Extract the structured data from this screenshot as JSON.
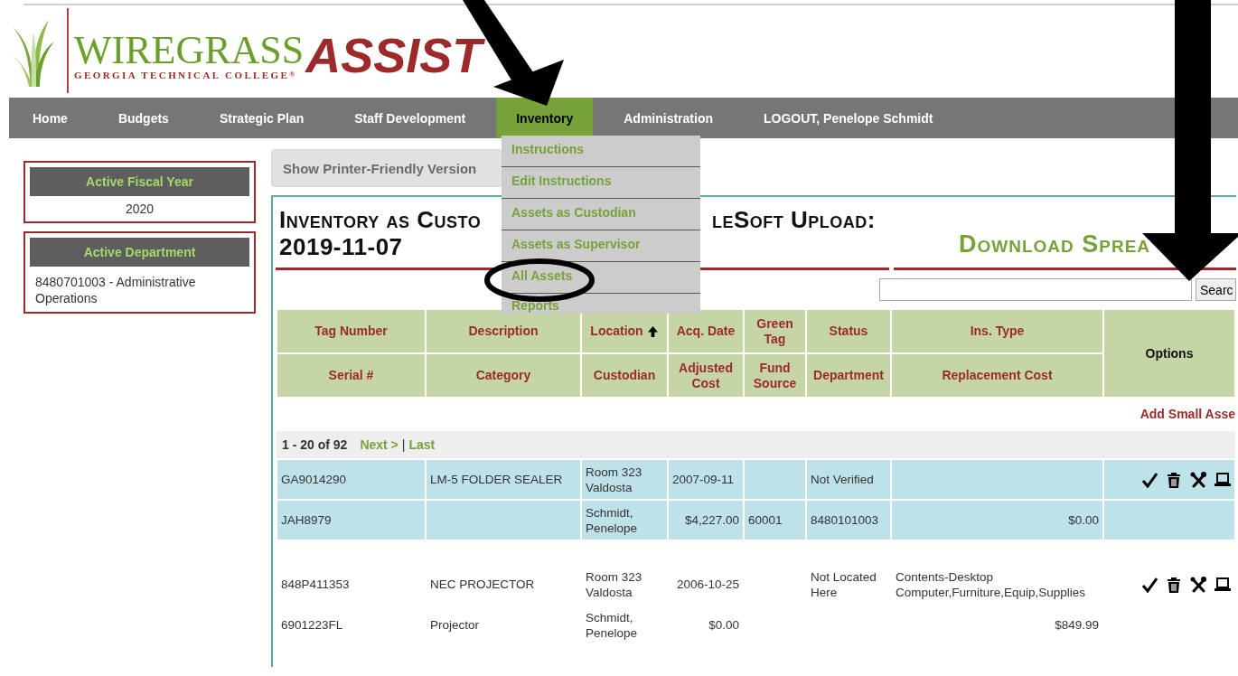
{
  "logo": {
    "name": "WIREGRASS",
    "subtitle": "GEORGIA TECHNICAL COLLEGE",
    "registered": "®",
    "app": "ASSIST"
  },
  "nav": [
    {
      "label": "Home",
      "selected": false
    },
    {
      "label": "Budgets",
      "selected": false
    },
    {
      "label": "Strategic Plan",
      "selected": false
    },
    {
      "label": "Staff Development",
      "selected": false
    },
    {
      "label": "Inventory",
      "selected": true
    },
    {
      "label": "Administration",
      "selected": false
    },
    {
      "label": "LOGOUT, Penelope Schmidt",
      "selected": false
    }
  ],
  "dropdown": {
    "items": [
      "Instructions",
      "Edit Instructions",
      "Assets as Custodian",
      "Assets as Supervisor",
      "All Assets",
      "Reports"
    ]
  },
  "sidebar": [
    {
      "kind": "centered",
      "title": "Active Fiscal Year",
      "value": "2020"
    },
    {
      "kind": "left",
      "title": "Active Department",
      "value": "8480701003 - Administrative Operations"
    }
  ],
  "printer_button": "Show Printer-Friendly Version",
  "heading": {
    "parts": [
      "Inventory as Custo",
      "leSoft Upload:"
    ],
    "date": "2019-11-07"
  },
  "download_link": "Download Sprea",
  "search": {
    "button": "Searc"
  },
  "table": {
    "header_rows": [
      [
        {
          "label": "Tag Number",
          "sorted": false
        },
        {
          "label": "Description",
          "sorted": false
        },
        {
          "label": "Location",
          "sorted": true
        },
        {
          "label": "Acq. Date",
          "sorted": false
        },
        {
          "label": "Green Tag",
          "sorted": false
        },
        {
          "label": "Status",
          "sorted": false
        },
        {
          "label": "Ins. Type",
          "sorted": false
        }
      ],
      [
        {
          "label": "Serial #",
          "sorted": false
        },
        {
          "label": "Category",
          "sorted": false
        },
        {
          "label": "Custodian",
          "sorted": false
        },
        {
          "label": "Adjusted Cost",
          "sorted": false
        },
        {
          "label": "Fund Source",
          "sorted": false
        },
        {
          "label": "Department",
          "sorted": false
        },
        {
          "label": "Replacement Cost",
          "sorted": false
        }
      ]
    ],
    "options_header": "Options"
  },
  "add_link": "Add Small Asse",
  "pagination": {
    "range": "1 - 20 of 92",
    "next": "Next >",
    "separator": "|",
    "last": "Last"
  },
  "records": [
    {
      "selected": true,
      "tag_number": "GA9014290",
      "description": "LM-5 FOLDER SEALER",
      "location": "Room 323 Valdosta",
      "acq_date": "2007-09-11",
      "status": "Not Verified",
      "serial": "JAH8979",
      "custodian": "Schmidt, Penelope",
      "adjusted_cost": "$4,227.00",
      "fund_source": "60001",
      "department": "8480101003",
      "replacement_cost": "$0.00"
    },
    {
      "selected": false,
      "tag_number": "848P411353",
      "description": "NEC PROJECTOR",
      "location": "Room 323 Valdosta",
      "acq_date": "2006-10-25",
      "status": "Not Located Here",
      "ins_type": "Contents-Desktop Computer,Furniture,Equip,Supplies",
      "serial": "6901223FL",
      "category": "Projector",
      "custodian": "Schmidt, Penelope",
      "adjusted_cost": "$0.00",
      "replacement_cost": "$849.99"
    }
  ]
}
